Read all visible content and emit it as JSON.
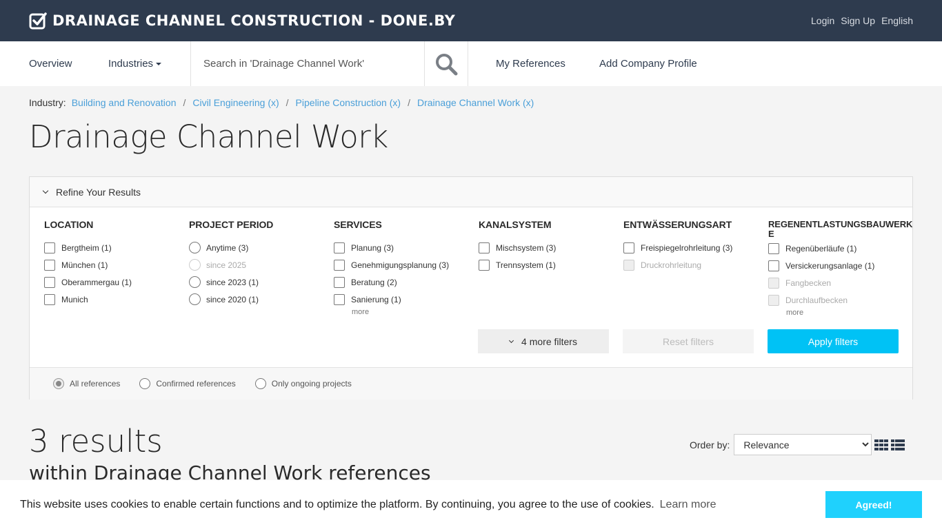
{
  "brand": {
    "title": "DRAINAGE CHANNEL CONSTRUCTION - DONE.BY"
  },
  "toplinks": [
    "Login",
    "Sign Up",
    "English"
  ],
  "nav": {
    "overview": "Overview",
    "industries": "Industries",
    "search_placeholder": "Search in 'Drainage Channel Work'",
    "my_references": "My References",
    "add_company": "Add Company Profile"
  },
  "breadcrumb": {
    "label": "Industry:",
    "items": [
      "Building and Renovation",
      "Civil Engineering (x)",
      "Pipeline Construction (x)",
      "Drainage Channel Work (x)"
    ]
  },
  "page_title": "Drainage Channel Work",
  "filters": {
    "header": "Refine Your Results",
    "columns": [
      {
        "title": "LOCATION",
        "type": "checkbox",
        "options": [
          {
            "label": "Bergtheim (1)",
            "disabled": false
          },
          {
            "label": "München (1)",
            "disabled": false
          },
          {
            "label": "Oberammergau (1)",
            "disabled": false
          },
          {
            "label": "Munich",
            "disabled": false
          }
        ],
        "more": ""
      },
      {
        "title": "PROJECT PERIOD",
        "type": "radio",
        "options": [
          {
            "label": "Anytime (3)",
            "disabled": false
          },
          {
            "label": "since 2025",
            "disabled": true
          },
          {
            "label": "since 2023 (1)",
            "disabled": false
          },
          {
            "label": "since 2020 (1)",
            "disabled": false
          }
        ],
        "more": ""
      },
      {
        "title": "SERVICES",
        "type": "checkbox",
        "options": [
          {
            "label": "Planung (3)",
            "disabled": false
          },
          {
            "label": "Genehmigungsplanung (3)",
            "disabled": false
          },
          {
            "label": "Beratung (2)",
            "disabled": false
          },
          {
            "label": "Sanierung (1)",
            "disabled": false
          }
        ],
        "more": "more"
      },
      {
        "title": "KANALSYSTEM",
        "type": "checkbox",
        "options": [
          {
            "label": "Mischsystem (3)",
            "disabled": false
          },
          {
            "label": "Trennsystem (1)",
            "disabled": false
          }
        ],
        "more": ""
      },
      {
        "title": "ENTWÄSSERUNGSART",
        "type": "checkbox",
        "options": [
          {
            "label": "Freispiegelrohrleitung (3)",
            "disabled": false
          },
          {
            "label": "Druckrohrleitung",
            "disabled": true
          }
        ],
        "more": ""
      },
      {
        "title": "REGENENTLASTUNGSBAUWERKE",
        "type": "checkbox",
        "options": [
          {
            "label": "Regenüberläufe (1)",
            "disabled": false
          },
          {
            "label": "Versickerungsanlage (1)",
            "disabled": false
          },
          {
            "label": "Fangbecken",
            "disabled": true
          },
          {
            "label": "Durchlaufbecken",
            "disabled": true
          }
        ],
        "more": "more"
      }
    ],
    "more_filters": "4 more filters",
    "reset": "Reset filters",
    "apply": "Apply filters",
    "scope": [
      {
        "label": "All references",
        "checked": true
      },
      {
        "label": "Confirmed references",
        "checked": false
      },
      {
        "label": "Only ongoing projects",
        "checked": false
      }
    ]
  },
  "results": {
    "count": "3 results",
    "subtitle": "within Drainage Channel Work references",
    "order_label": "Order by:",
    "order_value": "Relevance"
  },
  "cookie": {
    "text": "This website uses cookies to enable certain functions and to optimize the platform. By continuing, you agree to the use of cookies.",
    "learn_more": "Learn more",
    "agree": "Agreed!"
  },
  "colors": {
    "topbar": "#2e3b4e",
    "link": "#4a9fd8",
    "accent": "#00c2f5"
  },
  "icons": [
    "checkbox-logo-icon",
    "search-icon",
    "grid-view-icon",
    "list-view-icon"
  ]
}
